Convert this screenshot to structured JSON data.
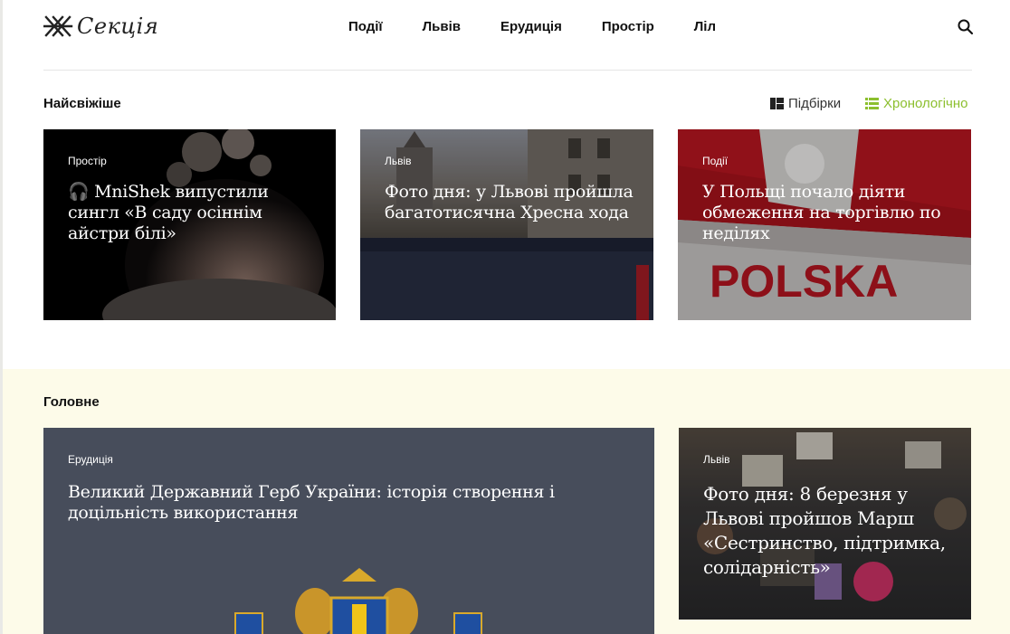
{
  "header": {
    "logo_text": "Секція",
    "nav": [
      "Події",
      "Львів",
      "Ерудиція",
      "Простір",
      "Ліл"
    ]
  },
  "latest": {
    "title": "Найсвіжіше",
    "views": {
      "collections": "Підбірки",
      "chronological": "Хронологічно"
    },
    "cards": [
      {
        "category": "Простір",
        "title": "🎧 MniShek випустили сингл «В саду осіннім айстри білі»"
      },
      {
        "category": "Львів",
        "title": "Фото дня: у Львові пройшла багатотисячна Хресна хода"
      },
      {
        "category": "Події",
        "title": "У Польщі почало діяти обмеження на торгівлю по неділях"
      }
    ]
  },
  "main": {
    "title": "Головне",
    "cards": [
      {
        "category": "Ерудиція",
        "title": "Великий Державний Герб України: історія створення і доцільність використання"
      },
      {
        "category": "Львів",
        "title": "Фото дня: 8 березня у Львові пройшов Марш «Сестринство, підтримка, солідарність»"
      }
    ]
  },
  "colors": {
    "accent": "#8cbf2e",
    "band_bg": "#fdfbe9",
    "coat_card_bg": "#474d5b"
  },
  "image_text": {
    "polska_banner": "POLSKA"
  }
}
